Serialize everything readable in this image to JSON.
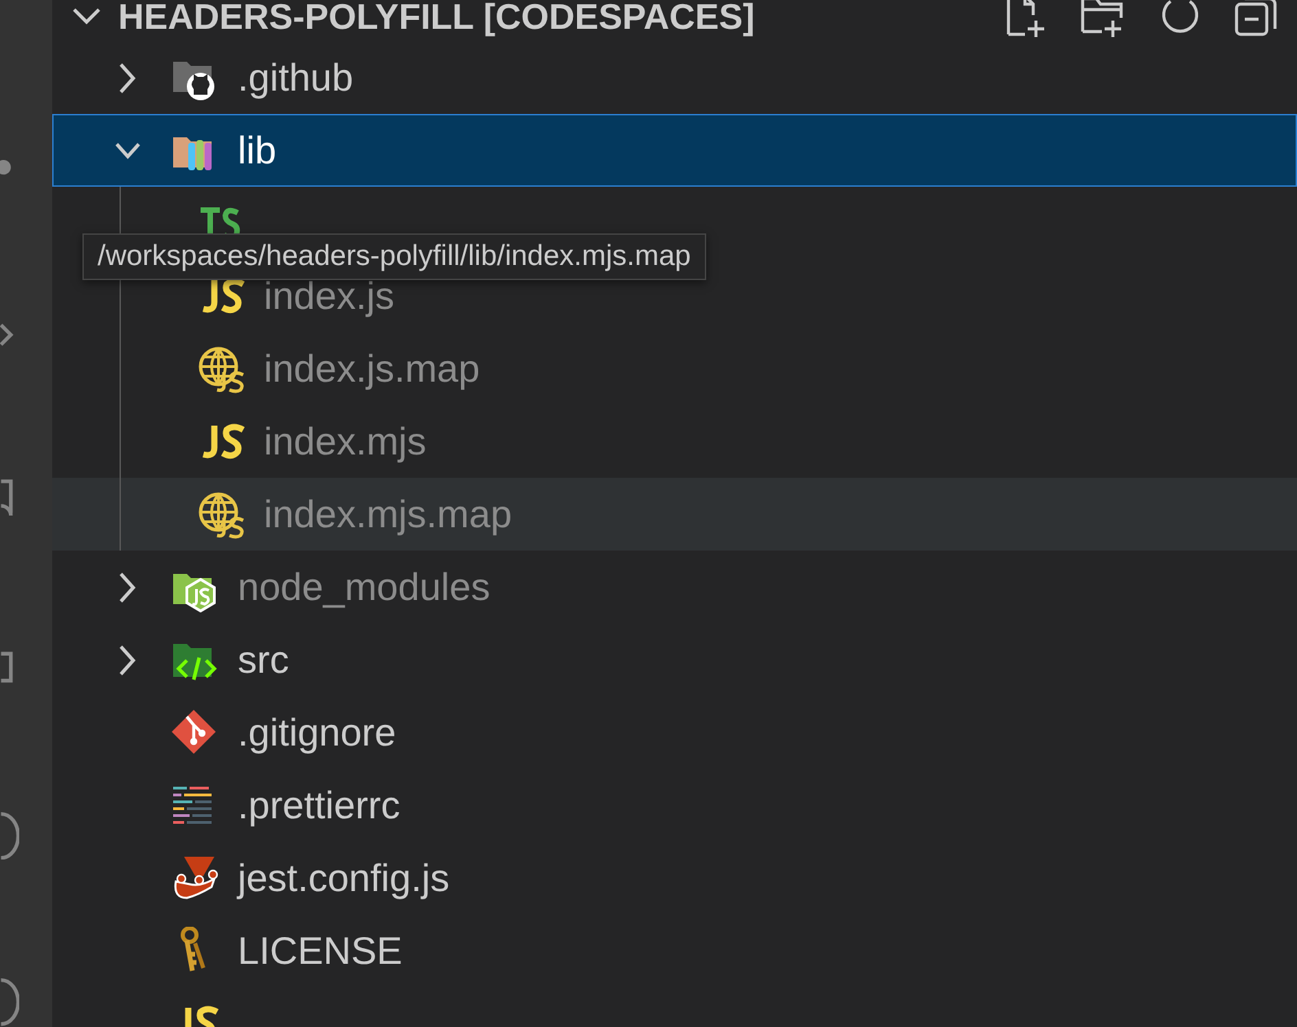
{
  "explorer": {
    "title": "HEADERS-POLYFILL [CODESPACES]",
    "expanded": true,
    "actions": [
      {
        "kind": "new-file"
      },
      {
        "kind": "new-folder"
      },
      {
        "kind": "refresh"
      },
      {
        "kind": "collapse"
      }
    ],
    "tree": [
      {
        "name": ".github",
        "kind": "folder",
        "expanded": false,
        "selected": false,
        "hovered": false,
        "ignored": false
      },
      {
        "name": "lib",
        "kind": "folder",
        "expanded": true,
        "selected": true,
        "hovered": false,
        "ignored": false,
        "children": [
          {
            "kind": "file",
            "selected": false,
            "hovered": false
          },
          {
            "name": "index.js",
            "kind": "file",
            "selected": false,
            "hovered": false,
            "ignored": true
          },
          {
            "name": "index.js.map",
            "kind": "file",
            "selected": false,
            "hovered": false,
            "ignored": true
          },
          {
            "name": "index.mjs",
            "kind": "file",
            "selected": false,
            "hovered": false,
            "ignored": true
          },
          {
            "name": "index.mjs.map",
            "kind": "file",
            "selected": false,
            "hovered": true,
            "ignored": true
          }
        ]
      },
      {
        "name": "node_modules",
        "kind": "folder",
        "expanded": false,
        "selected": false,
        "hovered": false,
        "ignored": true
      },
      {
        "name": "src",
        "kind": "folder",
        "expanded": false,
        "selected": false,
        "hovered": false,
        "ignored": false
      },
      {
        "name": ".gitignore",
        "kind": "file",
        "selected": false,
        "hovered": false,
        "ignored": false
      },
      {
        "name": ".prettierrc",
        "kind": "file",
        "selected": false,
        "hovered": false,
        "ignored": false
      },
      {
        "name": "jest.config.js",
        "kind": "file",
        "selected": false,
        "hovered": false,
        "ignored": false
      },
      {
        "name": "LICENSE",
        "kind": "file",
        "selected": false,
        "hovered": false,
        "ignored": false
      },
      {
        "kind": "file",
        "selected": false,
        "hovered": false
      }
    ]
  },
  "tooltip": {
    "text": "/workspaces/headers-polyfill/lib/index.mjs.map"
  }
}
